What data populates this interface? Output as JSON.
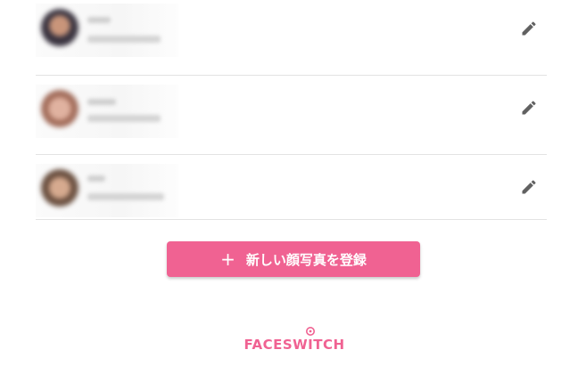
{
  "list": {
    "items": [
      {
        "id": 0,
        "avatar": "blurred-photo",
        "name": "",
        "date": ""
      },
      {
        "id": 1,
        "avatar": "blurred-photo",
        "name": "",
        "date": ""
      },
      {
        "id": 2,
        "avatar": "blurred-photo",
        "name": "",
        "date": ""
      }
    ],
    "edit_icon": "pencil-icon"
  },
  "register_button": {
    "icon": "plus",
    "plus_glyph": "+",
    "label": "新しい顔写真を登録"
  },
  "brand": {
    "logo_text": "FACESWITCH",
    "color": "#f06292"
  },
  "colors": {
    "accent": "#f06292",
    "icon": "#616161",
    "divider": "#e3e3e3"
  }
}
